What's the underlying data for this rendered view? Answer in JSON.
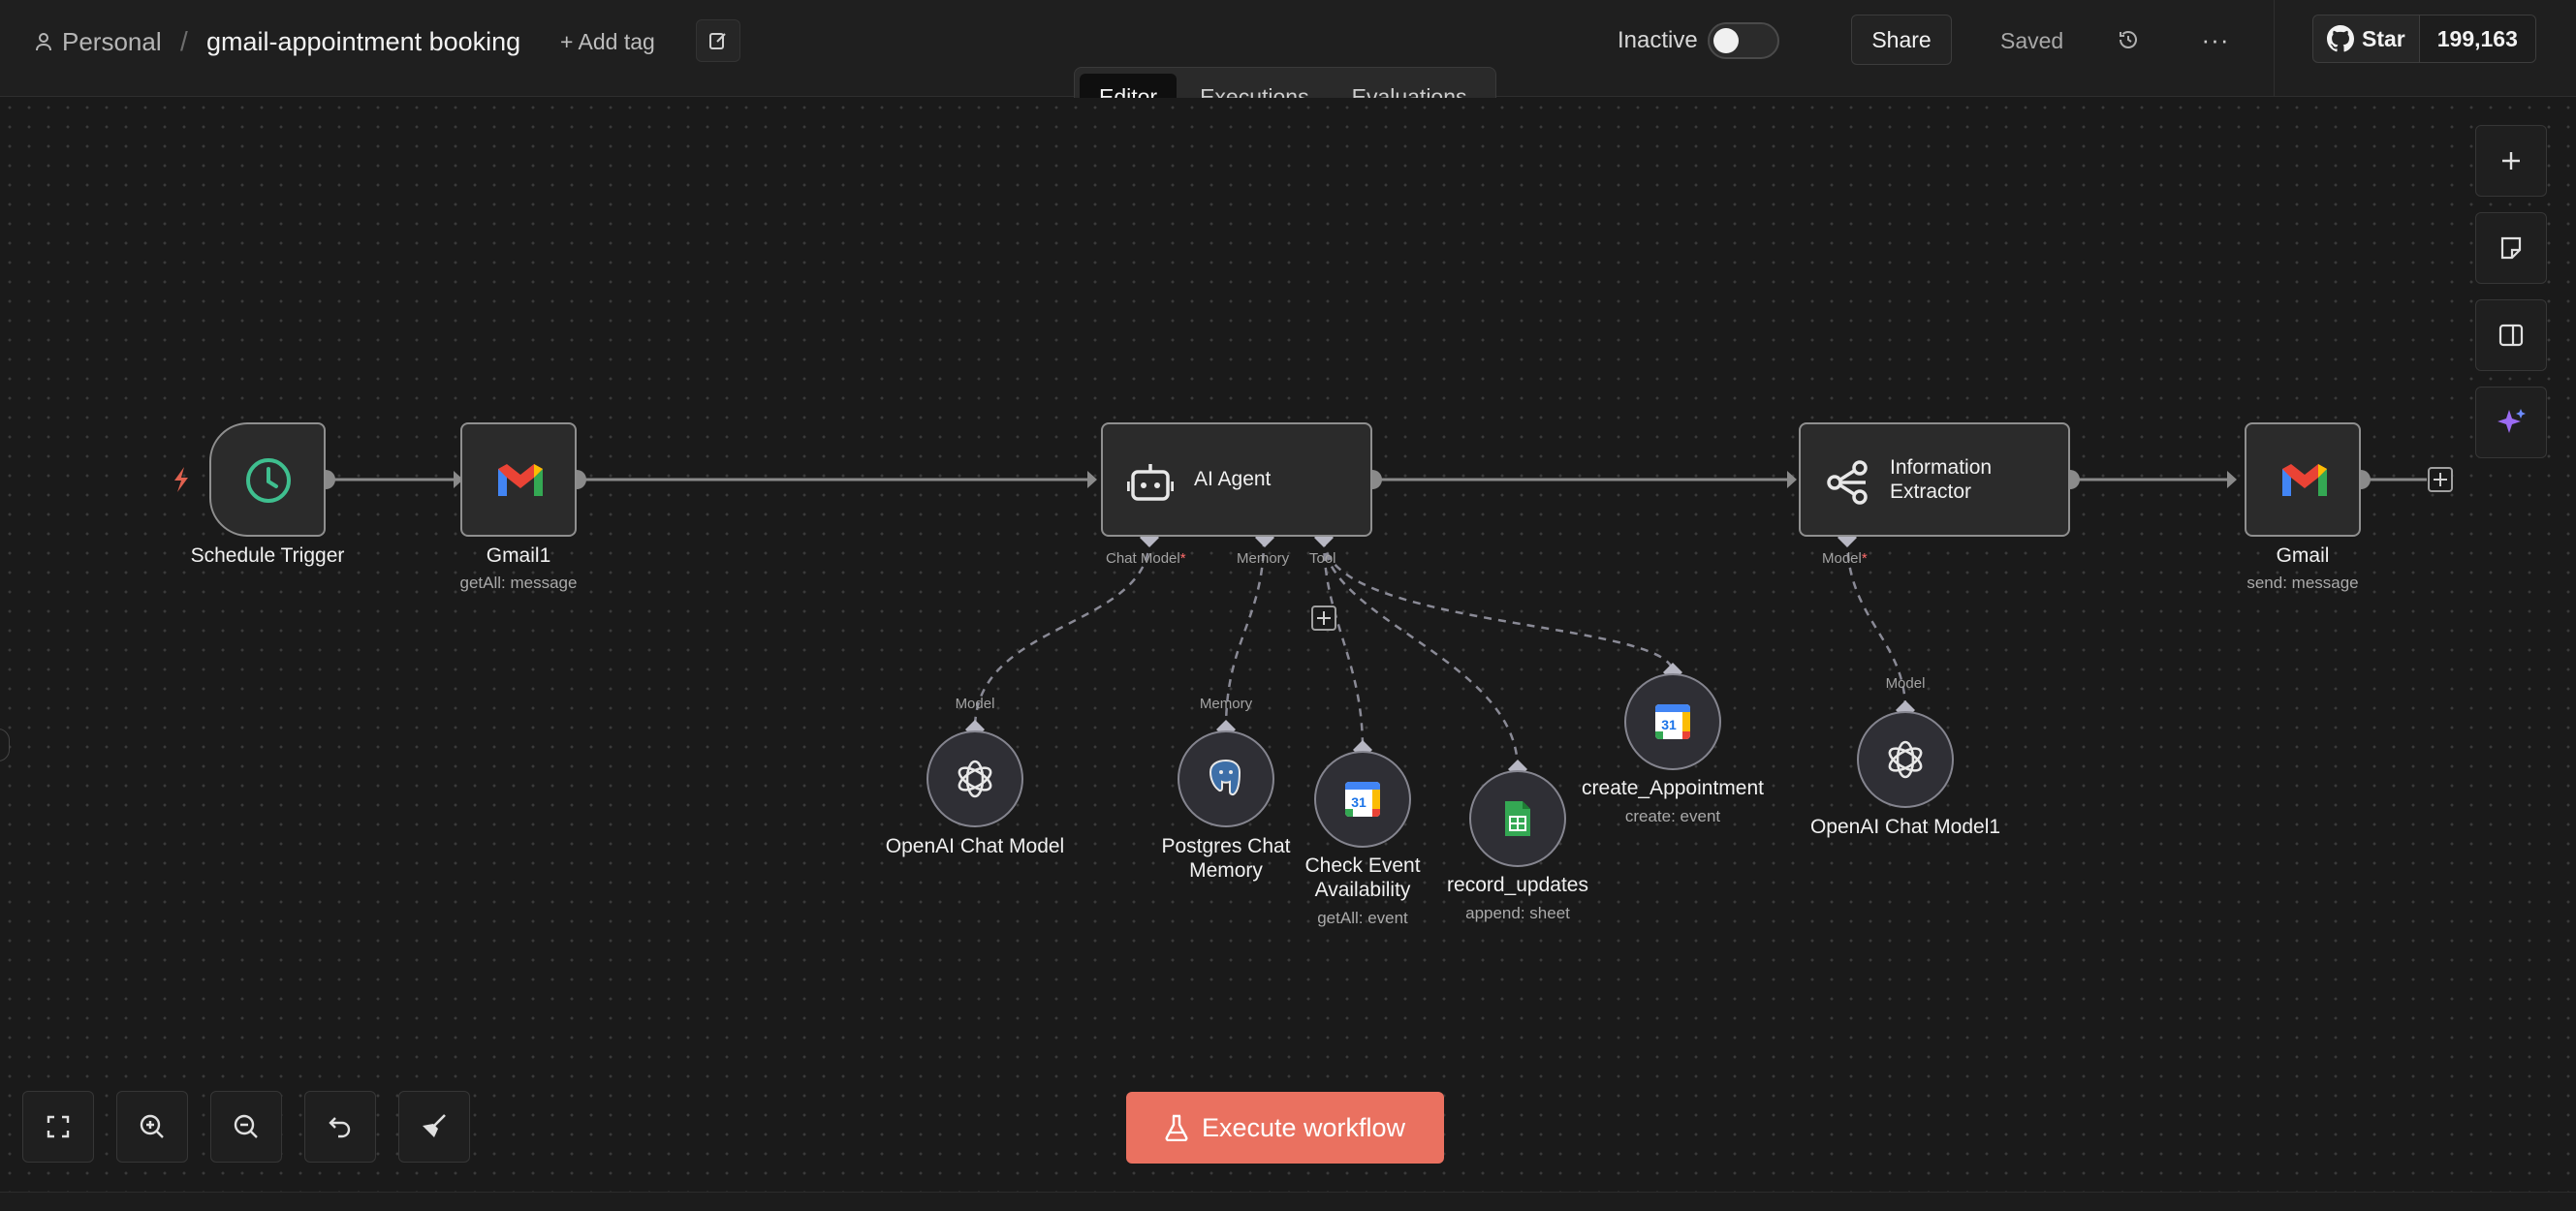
{
  "header": {
    "project": "Personal",
    "separator": "/",
    "workflow_name": "gmail-appointment booking",
    "add_tag": "+ Add tag",
    "status_label": "Inactive",
    "share_label": "Share",
    "saved_label": "Saved",
    "more_label": "···",
    "github_star_label": "Star",
    "github_star_count": "199,163"
  },
  "tabs": [
    {
      "label": "Editor",
      "active": true
    },
    {
      "label": "Executions",
      "active": false
    },
    {
      "label": "Evaluations",
      "active": false
    }
  ],
  "nodes": {
    "schedule_trigger": {
      "name": "Schedule Trigger"
    },
    "gmail1": {
      "name": "Gmail1",
      "subtitle": "getAll: message"
    },
    "ai_agent": {
      "name": "AI Agent",
      "ports": {
        "chat_model": "Chat Model",
        "memory": "Memory",
        "tool": "Tool"
      }
    },
    "information_extractor": {
      "name_line1": "Information",
      "name_line2": "Extractor",
      "ports": {
        "model": "Model"
      }
    },
    "gmail": {
      "name": "Gmail",
      "subtitle": "send: message"
    },
    "openai_chat_model": {
      "name": "OpenAI Chat Model",
      "port": "Model"
    },
    "postgres_chat_memory": {
      "name_line1": "Postgres Chat",
      "name_line2": "Memory",
      "port": "Memory"
    },
    "check_event_availability": {
      "name_line1": "Check Event",
      "name_line2": "Availability",
      "subtitle": "getAll: event"
    },
    "record_updates": {
      "name": "record_updates",
      "subtitle": "append: sheet"
    },
    "create_appointment": {
      "name": "create_Appointment",
      "subtitle": "create: event"
    },
    "openai_chat_model1": {
      "name": "OpenAI Chat Model1",
      "port": "Model"
    }
  },
  "required_marker": "*",
  "calendar_day": "31",
  "execute_button": "Execute workflow",
  "colors": {
    "accent": "#ea7160",
    "trigger_icon": "#3fbf8f",
    "gmail_red": "#ea4335",
    "sheets_green": "#34a853",
    "ai_sparkle": "#9b6bf2"
  },
  "icons": {
    "schedule_trigger": "clock-icon",
    "gmail": "gmail-icon",
    "ai_agent": "robot-icon",
    "information_extractor": "extractor-icon",
    "openai": "openai-icon",
    "postgres": "postgres-icon",
    "google_calendar": "google-calendar-icon",
    "google_sheets": "google-sheets-icon"
  }
}
